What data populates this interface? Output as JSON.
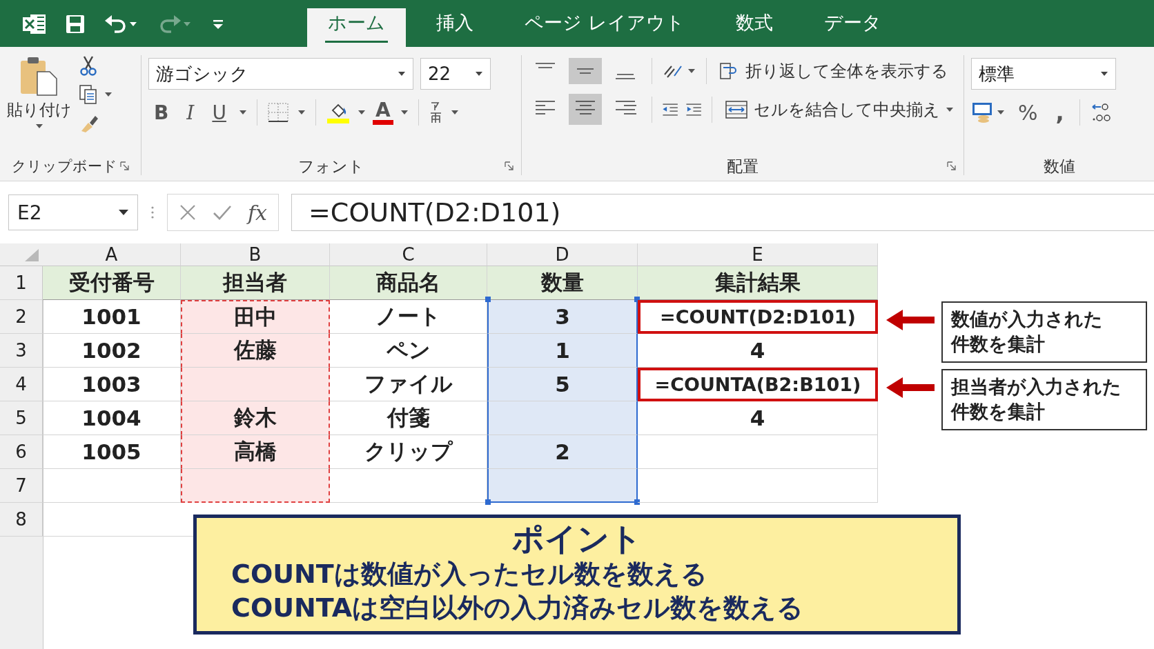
{
  "title_bar": {
    "redo_disabled": true
  },
  "tabs": [
    {
      "label": "ホーム",
      "selected": true
    },
    {
      "label": "挿入",
      "selected": false
    },
    {
      "label": "ページ レイアウト",
      "selected": false
    },
    {
      "label": "数式",
      "selected": false
    },
    {
      "label": "データ",
      "selected": false
    }
  ],
  "ribbon": {
    "paste_label": "貼り付け",
    "font_name": "游ゴシック",
    "font_size": "22",
    "format_buttons": [
      "B",
      "I",
      "U",
      "A"
    ],
    "wrap_text": "折り返して全体を表示する",
    "merge_center": "セルを結合して中央揃え",
    "number_format": "標準",
    "number_buttons": [
      "%",
      ","
    ],
    "vertical_align": [
      {
        "selected": false
      },
      {
        "selected": true
      },
      {
        "selected": false
      }
    ],
    "horizontal_align": [
      {
        "selected": false
      },
      {
        "selected": true
      },
      {
        "selected": false
      }
    ],
    "groups": [
      "クリップボード",
      "フォント",
      "配置",
      "数値"
    ]
  },
  "formula_bar": {
    "name_box": "E2",
    "fx": "fx",
    "formula": "=COUNT(D2:D101)"
  },
  "sheet": {
    "columns": [
      {
        "label": "A",
        "dashed_range": false,
        "selected_range": false
      },
      {
        "label": "B",
        "dashed_range": true,
        "selected_range": false
      },
      {
        "label": "C",
        "dashed_range": false,
        "selected_range": false
      },
      {
        "label": "D",
        "dashed_range": false,
        "selected_range": true
      },
      {
        "label": "E",
        "dashed_range": false,
        "selected_range": false
      }
    ],
    "rows": [
      {
        "number": "1",
        "kind": "header",
        "cells": [
          {
            "text": "受付番号",
            "boxed": false
          },
          {
            "text": "担当者",
            "boxed": false
          },
          {
            "text": "商品名",
            "boxed": false
          },
          {
            "text": "数量",
            "boxed": false
          },
          {
            "text": "集計結果",
            "boxed": false
          }
        ]
      },
      {
        "number": "2",
        "kind": "data",
        "cells": [
          {
            "text": "1001",
            "boxed": false
          },
          {
            "text": "田中",
            "boxed": false
          },
          {
            "text": "ノート",
            "boxed": false
          },
          {
            "text": "3",
            "boxed": false
          },
          {
            "text": "=COUNT(D2:D101)",
            "boxed": true
          }
        ]
      },
      {
        "number": "3",
        "kind": "data",
        "cells": [
          {
            "text": "1002",
            "boxed": false
          },
          {
            "text": "佐藤",
            "boxed": false
          },
          {
            "text": "ペン",
            "boxed": false
          },
          {
            "text": "1",
            "boxed": false
          },
          {
            "text": "4",
            "boxed": false
          }
        ]
      },
      {
        "number": "4",
        "kind": "data",
        "cells": [
          {
            "text": "1003",
            "boxed": false
          },
          null,
          {
            "text": "ファイル",
            "boxed": false
          },
          {
            "text": "5",
            "boxed": false
          },
          {
            "text": "=COUNTA(B2:B101)",
            "boxed": true
          }
        ]
      },
      {
        "number": "5",
        "kind": "data",
        "cells": [
          {
            "text": "1004",
            "boxed": false
          },
          {
            "text": "鈴木",
            "boxed": false
          },
          {
            "text": "付箋",
            "boxed": false
          },
          null,
          {
            "text": "4",
            "boxed": false
          }
        ]
      },
      {
        "number": "6",
        "kind": "data",
        "cells": [
          {
            "text": "1005",
            "boxed": false
          },
          {
            "text": "高橋",
            "boxed": false
          },
          {
            "text": "クリップ",
            "boxed": false
          },
          {
            "text": "2",
            "boxed": false
          },
          null
        ]
      },
      {
        "number": "7",
        "kind": "data",
        "cells": [
          null,
          null,
          null,
          null,
          null
        ]
      },
      {
        "number": "8",
        "kind": "blank",
        "cells": [
          null,
          null,
          null,
          null,
          null
        ]
      }
    ]
  },
  "callouts": [
    {
      "lines": [
        "数値が入力された",
        "件数を集計"
      ]
    },
    {
      "lines": [
        "担当者が入力された",
        "件数を集計"
      ]
    }
  ],
  "point_box": {
    "title": "ポイント",
    "lines": [
      "COUNTは数値が入ったセル数を数える",
      "COUNTAは空白以外の入力済みセル数を数える"
    ]
  }
}
